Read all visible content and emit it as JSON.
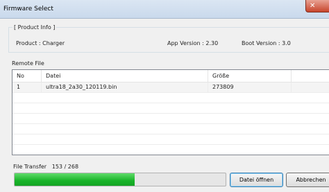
{
  "window": {
    "title": "Firmware Select",
    "close_glyph": "✕"
  },
  "product_info": {
    "legend": "[ Product Info ]",
    "product": "Product : Charger",
    "app_version": "App Version : 2.30",
    "boot_version": "Boot Version : 3.0"
  },
  "remote_file": {
    "label": "Remote File",
    "columns": [
      "No",
      "Datei",
      "Größe"
    ],
    "rows": [
      {
        "no": "1",
        "file": "ultra18_2a30_120119.bin",
        "size": "273809"
      }
    ]
  },
  "transfer": {
    "label": "File Transfer",
    "count": "153 / 268",
    "progress_fraction": 0.57,
    "bar_color": "#18b328"
  },
  "buttons": {
    "open": "Datei öffnen",
    "cancel": "Abbrechen"
  }
}
